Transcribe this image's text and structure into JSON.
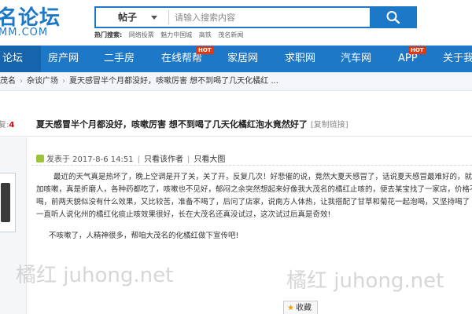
{
  "site": {
    "logo_main": "名论坛",
    "logo_sub": "MM.COM"
  },
  "search": {
    "category": "帖子",
    "placeholder": "请输入搜索内容",
    "hot_label": "热门搜索:",
    "hot_items": [
      "网络投票",
      "魅力中国城",
      "高铁",
      "茂名新闻"
    ]
  },
  "nav": {
    "items": [
      {
        "label": "论坛",
        "active": true
      },
      {
        "label": "房产网"
      },
      {
        "label": "二手房"
      },
      {
        "label": "在线帮帮",
        "badge": "HOT"
      },
      {
        "label": "家居网"
      },
      {
        "label": "求职网"
      },
      {
        "label": "汽车网"
      },
      {
        "label": "APP",
        "badge": "HOT"
      },
      {
        "label": "关于我"
      }
    ]
  },
  "breadcrumb": {
    "items": [
      "茂名",
      "杂谈广场",
      "夏天感冒半个月都没好，咳嗽厉害 想不到喝了几天化橘红 ..."
    ]
  },
  "thread": {
    "reply_prefix": "复:",
    "reply_count": "4",
    "title": "夏天感冒半个月都没好，咳嗽厉害 想不到喝了几天化橘红泡水竟然好了",
    "copy_link": "[复制链接]"
  },
  "post": {
    "posted_at": "发表于 2017-8-6 14:51",
    "author_only": "只看该作者",
    "large_image": "只看大图",
    "body_lines": [
      "最近的天气真是热坏了，晚上空调是开了关，关了开，反复几次！好悲催的说，竟然大夏天感冒了，话说夏天感冒最难好的，就",
      "加咳嗽，真是折磨人，各种药都吃了，咳嗽也不见好，郁闷之余突然想起来好像我大茂名的橘红止咳的，便去某宝找了一家店，价格不",
      "喝，前两天貌似没有什么效果，又比较苦，准备不喝了，后问了店家，说南方人体热，让我搭配了甘草和菊花一起泡喝，又坚持喝了",
      "一直听人说化州的橘红化痰止咳效果很好，长在大茂名还真没试过，这次试过后真是奇效!"
    ],
    "closing": "不咳嗽了，人精神很多，帮咱大茂名的化橘红做下宣传吧!"
  },
  "watermark": {
    "left": "橘红 juhong.net",
    "right": "橘红 juhong.net"
  },
  "actions": {
    "favorite": "收藏"
  },
  "colors": {
    "brand": "#1e78c8",
    "hot_badge": "#e8360c",
    "reply_count": "#dd0000"
  }
}
